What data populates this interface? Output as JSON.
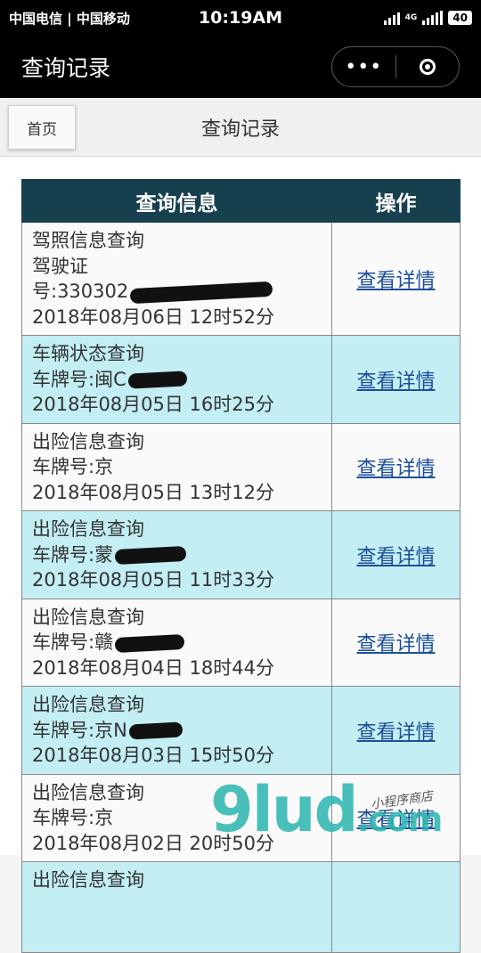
{
  "status_bar": {
    "carrier": "中国电信 | 中国移动",
    "time": "10:19AM",
    "network": "4G",
    "battery": "40"
  },
  "navbar": {
    "title": "查询记录",
    "more_icon": "ellipsis-icon",
    "close_icon": "target-circle-icon"
  },
  "page": {
    "home_button": "首页",
    "title": "查询记录"
  },
  "table": {
    "headers": [
      "查询信息",
      "操作"
    ],
    "rows": [
      {
        "type": "驾照信息查询",
        "line2": "驾驶证",
        "line3": "号:330302",
        "time": "2018年08月06日 12时52分",
        "action": "查看详情"
      },
      {
        "type": "车辆状态查询",
        "line2": "车牌号:闽C",
        "line3": "",
        "time": "2018年08月05日 16时25分",
        "action": "查看详情"
      },
      {
        "type": "出险信息查询",
        "line2": "车牌号:京",
        "line3": "",
        "time": "2018年08月05日 13时12分",
        "action": "查看详情"
      },
      {
        "type": "出险信息查询",
        "line2": "车牌号:蒙",
        "line3": "",
        "time": "2018年08月05日 11时33分",
        "action": "查看详情"
      },
      {
        "type": "出险信息查询",
        "line2": "车牌号:赣",
        "line3": "",
        "time": "2018年08月04日 18时44分",
        "action": "查看详情"
      },
      {
        "type": "出险信息查询",
        "line2": "车牌号:京N",
        "line3": "",
        "time": "2018年08月03日 15时50分",
        "action": "查看详情"
      },
      {
        "type": "出险信息查询",
        "line2": "车牌号:京",
        "line3": "",
        "time": "2018年08月02日 20时50分",
        "action": "查看详情"
      },
      {
        "type": "出险信息查询",
        "line2": "",
        "line3": "",
        "time": "",
        "action": ""
      }
    ]
  },
  "watermark": {
    "text": "9lud",
    "suffix": ".com",
    "sub": "小程序商店"
  }
}
